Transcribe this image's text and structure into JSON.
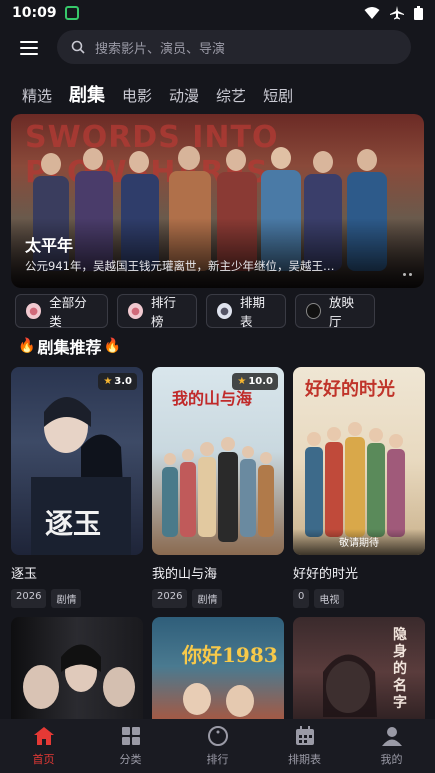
{
  "status_bar": {
    "time": "10:09"
  },
  "search": {
    "placeholder": "搜索影片、演员、导演"
  },
  "tabs": [
    {
      "label": "精选",
      "active": false
    },
    {
      "label": "剧集",
      "active": true
    },
    {
      "label": "电影",
      "active": false
    },
    {
      "label": "动漫",
      "active": false
    },
    {
      "label": "综艺",
      "active": false
    },
    {
      "label": "短剧",
      "active": false
    }
  ],
  "banner": {
    "bg_title": "SWORDS INTO PLOWSHARES",
    "title": "太平年",
    "description": "公元941年，吴越国王钱元瓘离世，新主少年继位，吴越王…"
  },
  "quick_links": [
    {
      "label": "全部分类",
      "icon": "pig-icon"
    },
    {
      "label": "排行榜",
      "icon": "pig-icon"
    },
    {
      "label": "排期表",
      "icon": "cat-icon"
    },
    {
      "label": "放映厅",
      "icon": "film-reel-icon"
    }
  ],
  "section": {
    "title": "剧集推荐"
  },
  "cards": [
    {
      "title": "逐玉",
      "rating": "3.0",
      "tags": [
        "2026",
        "剧情"
      ],
      "poster_text": "逐玉"
    },
    {
      "title": "我的山与海",
      "rating": "10.0",
      "tags": [
        "2026",
        "剧情"
      ],
      "poster_text": "我的山与海"
    },
    {
      "title": "好好的时光",
      "rating": "",
      "tags": [
        "0",
        "电视"
      ],
      "poster_text": "好好的时光",
      "badge": "敬请期待"
    }
  ],
  "cards_row2": [
    {
      "poster_text": ""
    },
    {
      "poster_text": "你好1983"
    },
    {
      "poster_text": "隐身的名字"
    }
  ],
  "bottom_nav": [
    {
      "label": "首页",
      "active": true,
      "icon": "home-icon"
    },
    {
      "label": "分类",
      "active": false,
      "icon": "grid-icon"
    },
    {
      "label": "排行",
      "active": false,
      "icon": "compass-icon"
    },
    {
      "label": "排期表",
      "active": false,
      "icon": "calendar-icon"
    },
    {
      "label": "我的",
      "active": false,
      "icon": "user-icon"
    }
  ],
  "colors": {
    "accent": "#e53935",
    "background": "#15161c",
    "star": "#f7b731"
  }
}
